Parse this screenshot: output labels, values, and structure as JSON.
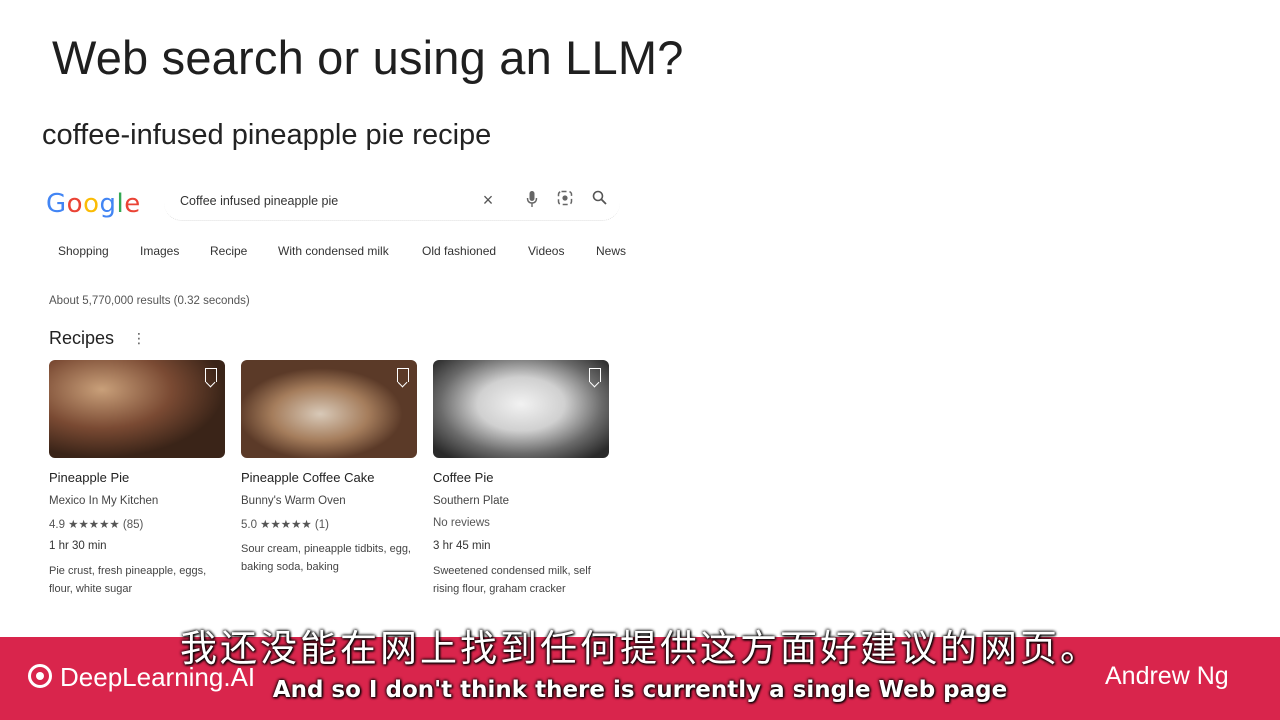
{
  "slide": {
    "title": "Web search or using an LLM?",
    "query": "coffee-infused pineapple pie recipe"
  },
  "google": {
    "logo_letters": [
      "G",
      "o",
      "o",
      "g",
      "l",
      "e"
    ],
    "logo_colors": [
      "#4285F4",
      "#EA4335",
      "#FBBC05",
      "#4285F4",
      "#34A853",
      "#EA4335"
    ],
    "search_value": "Coffee infused pineapple pie",
    "chips": [
      "Shopping",
      "Images",
      "Recipe",
      "With condensed milk",
      "Old fashioned",
      "Videos",
      "News"
    ],
    "stats": "About 5,770,000 results (0.32 seconds)",
    "recipes_heading": "Recipes",
    "cards": [
      {
        "title": "Pineapple Pie",
        "source": "Mexico In My Kitchen",
        "rating": "4.9 ★★★★★ (85)",
        "time": "1 hr 30 min",
        "ingredients": "Pie crust, fresh pineapple, eggs, flour, white sugar"
      },
      {
        "title": "Pineapple Coffee Cake",
        "source": "Bunny's Warm Oven",
        "rating": "5.0 ★★★★★ (1)",
        "time": "",
        "ingredients": "Sour cream, pineapple tidbits, egg, baking soda, baking"
      },
      {
        "title": "Coffee Pie",
        "source": "Southern Plate",
        "rating": "No reviews",
        "time": "3 hr 45 min",
        "ingredients": "Sweetened condensed milk, self rising flour, graham cracker"
      }
    ]
  },
  "footer": {
    "brand": "DeepLearning.AI",
    "presenter": "Andrew Ng",
    "subtitle_zh": "我还没能在网上找到任何提供这方面好建议的网页。",
    "subtitle_en": "And so I don't think there is currently a single Web page",
    "accent": "#d9254c"
  }
}
